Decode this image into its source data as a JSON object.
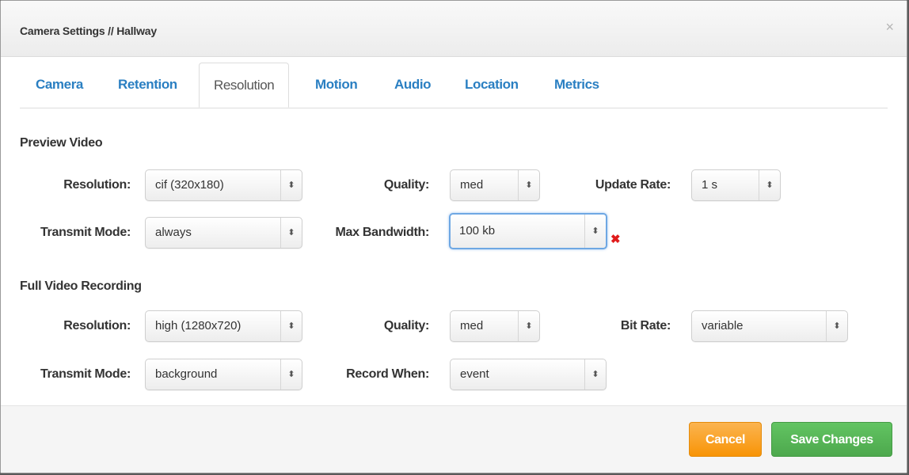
{
  "modal": {
    "title": "Camera Settings // Hallway",
    "close_glyph": "×"
  },
  "tabs": [
    {
      "label": "Camera",
      "active": false
    },
    {
      "label": "Retention",
      "active": false
    },
    {
      "label": "Resolution",
      "active": true
    },
    {
      "label": "Motion",
      "active": false
    },
    {
      "label": "Audio",
      "active": false
    },
    {
      "label": "Location",
      "active": false
    },
    {
      "label": "Metrics",
      "active": false
    }
  ],
  "preview": {
    "title": "Preview Video",
    "resolution": {
      "label": "Resolution:",
      "value": "cif (320x180)"
    },
    "quality": {
      "label": "Quality:",
      "value": "med"
    },
    "update_rate": {
      "label": "Update Rate:",
      "value": "1 s"
    },
    "transmit_mode": {
      "label": "Transmit Mode:",
      "value": "always"
    },
    "max_bandwidth": {
      "label": "Max Bandwidth:",
      "value": "100 kb",
      "error_glyph": "✖"
    }
  },
  "full": {
    "title": "Full Video Recording",
    "resolution": {
      "label": "Resolution:",
      "value": "high (1280x720)"
    },
    "quality": {
      "label": "Quality:",
      "value": "med"
    },
    "bit_rate": {
      "label": "Bit Rate:",
      "value": "variable"
    },
    "transmit_mode": {
      "label": "Transmit Mode:",
      "value": "background"
    },
    "record_when": {
      "label": "Record When:",
      "value": "event"
    }
  },
  "select_arrow_glyph": "⬍",
  "footer": {
    "cancel_label": "Cancel",
    "save_label": "Save Changes"
  },
  "colors": {
    "tab_link": "#2a7fc2",
    "cancel": "#f89406",
    "save": "#5bb75b",
    "error": "#e01b1b",
    "focus": "#6ea7e3"
  }
}
